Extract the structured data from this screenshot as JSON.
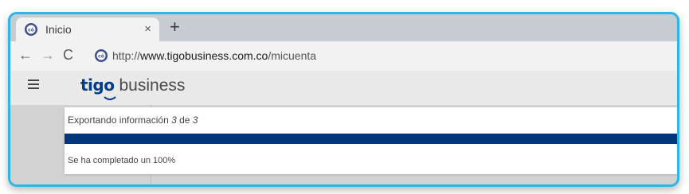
{
  "browser": {
    "tab": {
      "title": "Inicio",
      "close_glyph": "×",
      "favicon": "tigo-favicon-icon"
    },
    "new_tab_glyph": "+",
    "nav": {
      "back": "←",
      "forward": "→",
      "reload": "C"
    },
    "url": {
      "scheme": "http://",
      "host": "www.tigobusiness.com.co",
      "path": "/micuenta"
    }
  },
  "app": {
    "menu_icon": "hamburger-menu-icon",
    "logo": {
      "brand": "tigo",
      "suffix": "business",
      "brand_color": "#003b8c"
    }
  },
  "export": {
    "prefix": "Exportando información ",
    "current": "3",
    "separator": " de ",
    "total": "3",
    "progress_fraction": 1.0,
    "progress_color": "#00377b",
    "complete_text": "Se ha completado un 100%"
  },
  "colors": {
    "frame_border": "#29b7e8"
  }
}
